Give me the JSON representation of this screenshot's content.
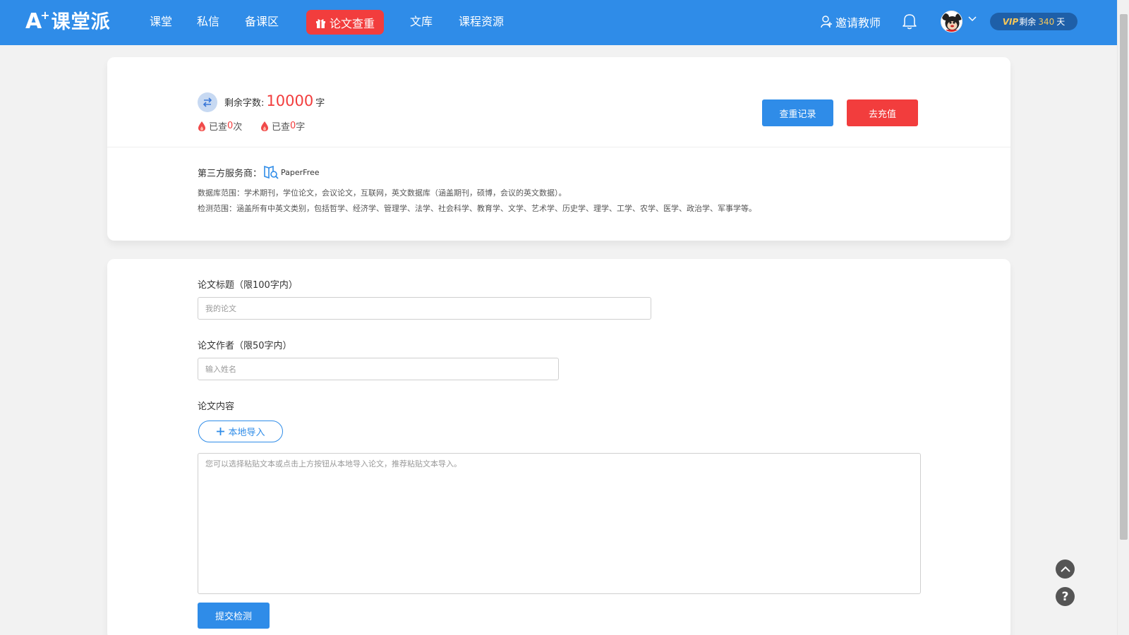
{
  "header": {
    "logo_letter": "A",
    "logo_plus": "+",
    "logo_text": "课堂派",
    "nav": [
      {
        "label": "课堂"
      },
      {
        "label": "私信"
      },
      {
        "label": "备课区"
      },
      {
        "label": "论文查重",
        "active": true
      },
      {
        "label": "文库"
      },
      {
        "label": "课程资源"
      }
    ],
    "invite_label": "邀请教师",
    "vip": {
      "tag": "VIP",
      "prefix": "剩余",
      "days": "340",
      "suffix": "天"
    },
    "colors": {
      "bar": "#2f8ce8",
      "active": "#f23d3d",
      "vip_bg": "#1e5fa8",
      "vip_text": "#f5c75a"
    }
  },
  "quota": {
    "label": "剩余字数:",
    "value": "10000",
    "unit": "字",
    "used_times_prefix": "已查",
    "used_times": "0",
    "used_times_suffix": "次",
    "used_words_prefix": "已查",
    "used_words": "0",
    "used_words_suffix": "字",
    "record_button": "查重记录",
    "recharge_button": "去充值"
  },
  "provider": {
    "label": "第三方服务商：",
    "name": "PaperFree",
    "database_scope": "数据库范围：学术期刊，学位论文，会议论文，互联网，英文数据库（涵盖期刊，硕博，会议的英文数据）。",
    "detect_scope": "检测范围：涵盖所有中英文类别，包括哲学、经济学、管理学、法学、社会科学、教育学、文学、艺术学、历史学、理学、工学、农学、医学、政治学、军事学等。"
  },
  "form": {
    "title_label": "论文标题（限100字内）",
    "title_placeholder": "我的论文",
    "author_label": "论文作者（限50字内）",
    "author_placeholder": "输入姓名",
    "content_label": "论文内容",
    "import_button": "本地导入",
    "content_placeholder": "您可以选择粘贴文本或点击上方按钮从本地导入论文，推荐粘贴文本导入。",
    "submit_button": "提交检测"
  },
  "float": {
    "top_icon": "chevron-up-icon",
    "help_icon": "question-icon",
    "help_glyph": "?"
  }
}
